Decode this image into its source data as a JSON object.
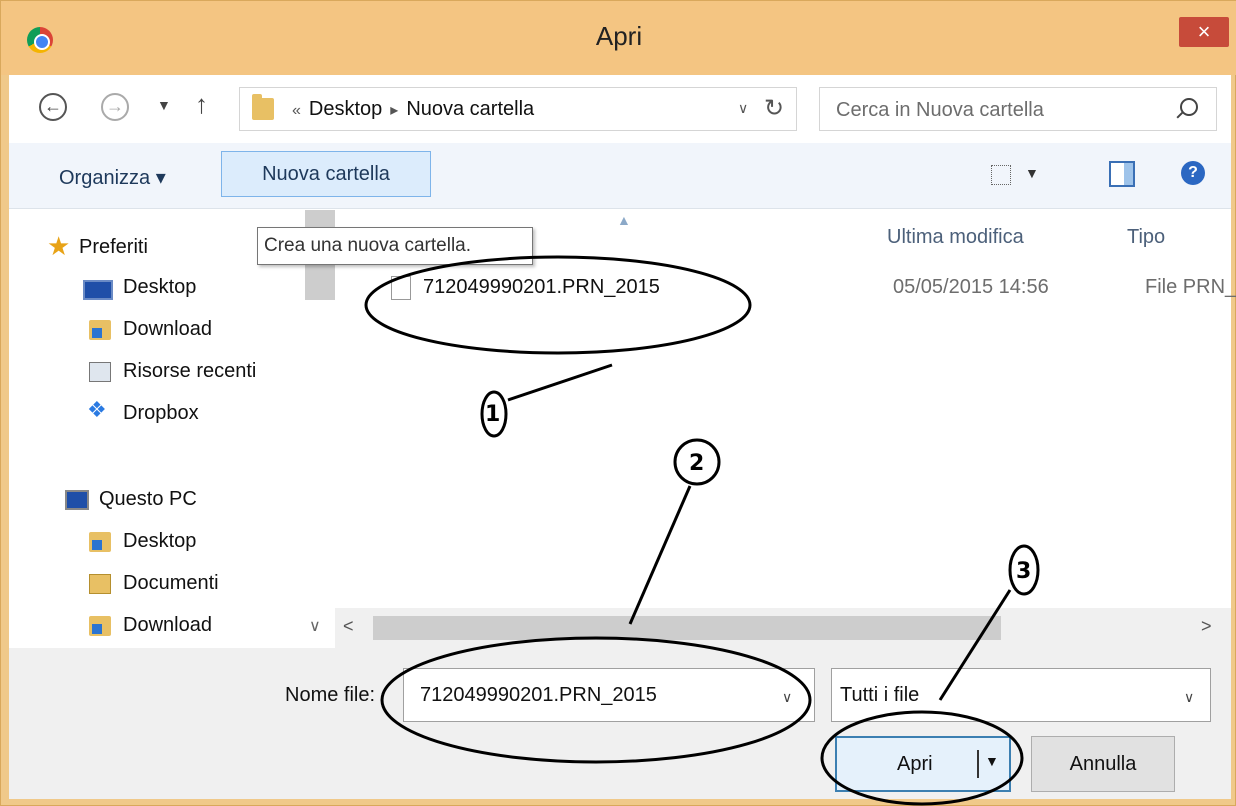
{
  "window": {
    "title": "Apri",
    "close_glyph": "×",
    "app_icon": "chrome-icon"
  },
  "address_bar": {
    "overflow": "«",
    "breadcrumbs": [
      "Desktop",
      "Nuova cartella"
    ],
    "separator": "▸",
    "search_placeholder": "Cerca in Nuova cartella"
  },
  "toolbar": {
    "organize_label": "Organizza ▾",
    "new_folder_label": "Nuova cartella",
    "tooltip": "Crea una nuova cartella."
  },
  "sidebar": {
    "favorites": {
      "label": "Preferiti",
      "items": [
        "Desktop",
        "Download",
        "Risorse recenti",
        "Dropbox"
      ]
    },
    "this_pc": {
      "label": "Questo PC",
      "items": [
        "Desktop",
        "Documenti",
        "Download"
      ]
    },
    "selected": "Desktop"
  },
  "file_list": {
    "columns": [
      "Ultima modifica",
      "Tipo"
    ],
    "rows": [
      {
        "name": "712049990201.PRN_2015",
        "modified": "05/05/2015 14:56",
        "type": "File PRN_"
      }
    ]
  },
  "bottom": {
    "filename_label": "Nome file:",
    "filename_value": "712049990201.PRN_2015",
    "filetype_value": "Tutti i file",
    "open_label": "Apri",
    "cancel_label": "Annulla"
  },
  "annotations": [
    "1",
    "2",
    "3"
  ]
}
